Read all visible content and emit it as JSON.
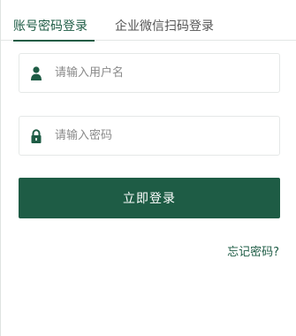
{
  "tabs": {
    "account_login": "账号密码登录",
    "wecom_login": "企业微信扫码登录"
  },
  "form": {
    "username_placeholder": "请输入用户名",
    "password_placeholder": "请输入密码",
    "username_value": "",
    "password_value": ""
  },
  "login_button": "立即登录",
  "forgot_password": "忘记密码?",
  "colors": {
    "primary": "#1e5c45",
    "border": "#e5e8e7",
    "placeholder": "#8a8a8a"
  },
  "icons": {
    "username": "user-icon",
    "password": "lock-icon"
  }
}
